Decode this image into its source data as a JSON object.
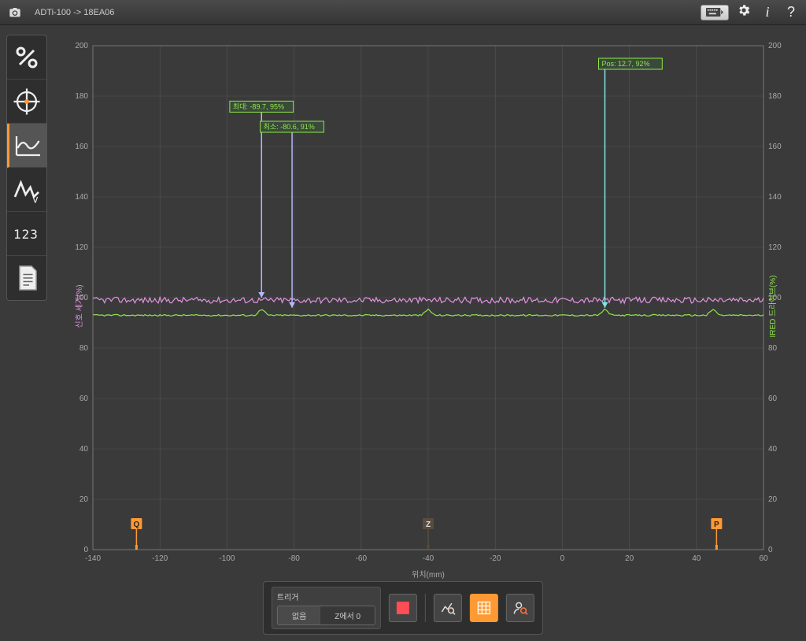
{
  "header": {
    "title": "ADTi-100 -> 18EA06"
  },
  "sidebar": {
    "tools": [
      "percent",
      "crosshair",
      "line-chart",
      "peak",
      "digits",
      "notes"
    ],
    "active_index": 2
  },
  "bottom": {
    "trigger_label": "트리거",
    "trigger_options": {
      "none": "없음",
      "z_at_zero": "Z에서 0"
    },
    "trigger_selected": "none"
  },
  "chart_data": {
    "type": "line",
    "title": "",
    "xlabel": "위치(mm)",
    "ylabel_left": "신호 세기(%)",
    "ylabel_right": "IRED 드라이브(%)",
    "xlim": [
      -140,
      60
    ],
    "ylim": [
      0,
      200
    ],
    "x_ticks": [
      -140,
      -120,
      -100,
      -80,
      -60,
      -40,
      -20,
      0,
      20,
      40,
      60
    ],
    "y_ticks": [
      0,
      20,
      40,
      60,
      80,
      100,
      120,
      140,
      160,
      180,
      200
    ],
    "markers_x": [
      {
        "label": "Q",
        "x": -127,
        "color": "#ff9933"
      },
      {
        "label": "Z",
        "x": -40,
        "color": "#584c3e"
      },
      {
        "label": "P",
        "x": 46,
        "color": "#ff9933"
      }
    ],
    "callouts": [
      {
        "id": "max",
        "text": "최대: -89.7, 95%",
        "x": -89.7,
        "box_y": 178,
        "arrow_to_y": 100,
        "box_color": "#8ee64a",
        "arrow_color": "#b5b8ff"
      },
      {
        "id": "min",
        "text": "최소: -80.6, 91%",
        "x": -80.6,
        "box_y": 170,
        "arrow_to_y": 96,
        "box_color": "#8ee64a",
        "arrow_color": "#b5b8ff"
      },
      {
        "id": "pos",
        "text": "Pos: 12.7, 92%",
        "x": 12.7,
        "box_y": 195,
        "arrow_to_y": 96,
        "box_color": "#8ee64a",
        "arrow_color": "#7fe7e7"
      }
    ],
    "series": [
      {
        "name": "signal-strength",
        "color": "#e294e2",
        "baseline": 99.0,
        "values_approx": "oscillates between ~98 and ~101 across full x range"
      },
      {
        "name": "ired-drive",
        "color": "#8ee64a",
        "baseline": 93.0,
        "peaks_at_x": [
          -89.7,
          -40,
          12.7,
          45
        ],
        "values_approx": "flat ~93 with small ~2-3% blips at peak locations"
      }
    ]
  }
}
